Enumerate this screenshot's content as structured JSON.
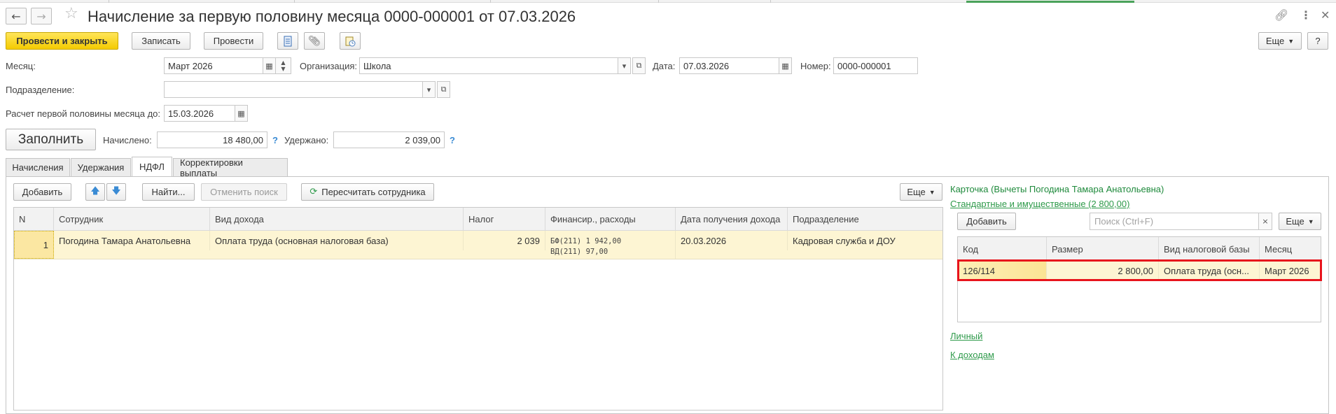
{
  "window": {
    "title": "Начисление за первую половину месяца 0000-000001 от 07.03.2026"
  },
  "toolbar": {
    "post_close": "Провести и закрыть",
    "save": "Записать",
    "post": "Провести",
    "more": "Еще",
    "help": "?"
  },
  "form": {
    "month_label": "Месяц:",
    "month_value": "Март 2026",
    "org_label": "Организация:",
    "org_value": "Школа",
    "date_label": "Дата:",
    "date_value": "07.03.2026",
    "number_label": "Номер:",
    "number_value": "0000-000001",
    "division_label": "Подразделение:",
    "division_value": "",
    "calc_until_label": "Расчет первой половины месяца до:",
    "calc_until_value": "15.03.2026",
    "fill_button": "Заполнить",
    "accrued_label": "Начислено:",
    "accrued_value": "18 480,00",
    "withheld_label": "Удержано:",
    "withheld_value": "2 039,00",
    "q": "?"
  },
  "tabs": [
    {
      "label": "Начисления"
    },
    {
      "label": "Удержания"
    },
    {
      "label": "НДФЛ"
    },
    {
      "label": "Корректировки выплаты"
    }
  ],
  "ndfl": {
    "add": "Добавить",
    "find": "Найти...",
    "cancel_search": "Отменить поиск",
    "recalc": "Пересчитать сотрудника",
    "more": "Еще",
    "columns": [
      "N",
      "Сотрудник",
      "Вид дохода",
      "Налог",
      "Финансир., расходы",
      "Дата получения дохода",
      "Подразделение"
    ],
    "rows": [
      {
        "n": "1",
        "employee": "Погодина Тамара Анатольевна",
        "income": "Оплата труда (основная налоговая база)",
        "tax": "2 039",
        "fin1": "БФ(211) 1 942,00",
        "fin2": "ВД(211) 97,00",
        "date": "20.03.2026",
        "division": "Кадровая служба и ДОУ"
      }
    ]
  },
  "card": {
    "title": "Карточка (Вычеты Погодина Тамара Анатольевна)",
    "standard_link": "Стандартные и имущественные (2 800,00)",
    "add": "Добавить",
    "search_placeholder": "Поиск (Ctrl+F)",
    "more": "Еще",
    "columns": [
      "Код",
      "Размер",
      "Вид налоговой базы",
      "Месяц"
    ],
    "rows": [
      {
        "code": "126/114",
        "amount": "2 800,00",
        "base": "Оплата труда (осн...",
        "month": "Март 2026"
      }
    ],
    "personal_link": "Личный",
    "to_income_link": "К доходам"
  },
  "colors": {
    "primary": "#f4cb00",
    "highlight_border": "#e8141c",
    "link": "#2e9a4a",
    "row_selected": "#fdf5d3"
  }
}
